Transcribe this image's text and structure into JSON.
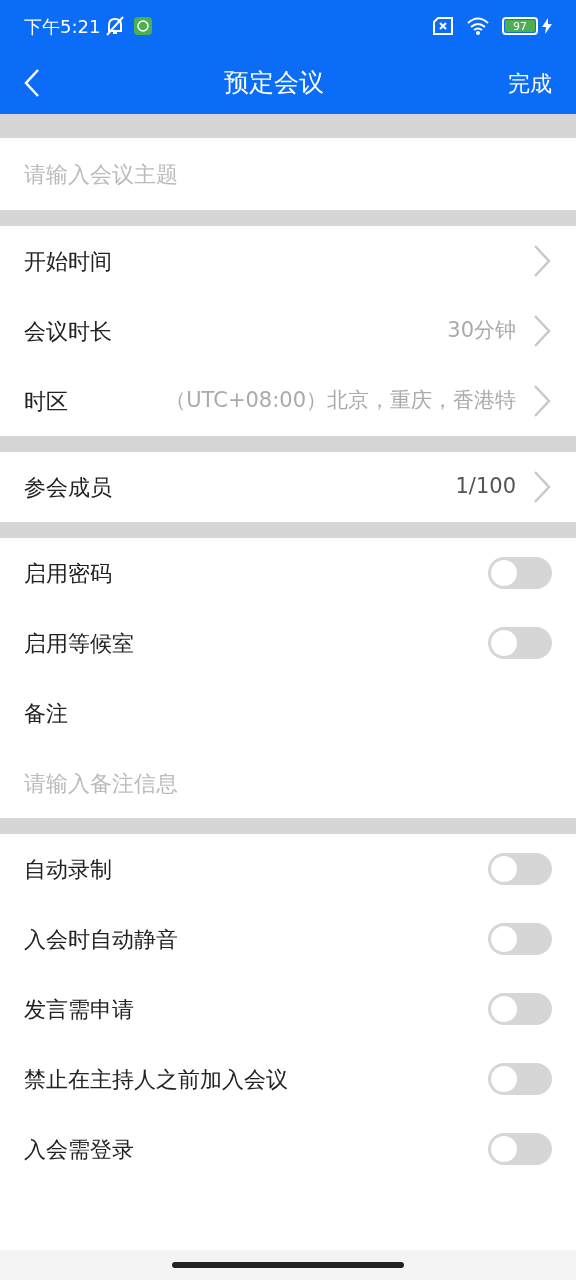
{
  "status_bar": {
    "time": "下午5:21",
    "battery": "97"
  },
  "nav": {
    "title": "预定会议",
    "action": "完成"
  },
  "topic": {
    "placeholder": "请输入会议主题"
  },
  "sections": [
    {
      "items": [
        {
          "kind": "nav",
          "label": "开始时间"
        },
        {
          "kind": "nav",
          "label": "会议时长",
          "value": "30分钟",
          "value_muted": true
        },
        {
          "kind": "nav",
          "label": "时区",
          "value": "（UTC+08:00）北京，重庆，香港特",
          "value_muted": true
        }
      ]
    },
    {
      "items": [
        {
          "kind": "nav",
          "label": "参会成员",
          "value": "1/100",
          "value_muted": false
        }
      ]
    },
    {
      "items": [
        {
          "kind": "toggle",
          "label": "启用密码",
          "on": false
        },
        {
          "kind": "toggle",
          "label": "启用等候室",
          "on": false
        },
        {
          "kind": "label",
          "label": "备注"
        },
        {
          "kind": "field",
          "placeholder": "请输入备注信息"
        }
      ]
    },
    {
      "items": [
        {
          "kind": "toggle",
          "label": "自动录制",
          "on": false
        },
        {
          "kind": "toggle",
          "label": "入会时自动静音",
          "on": false
        },
        {
          "kind": "toggle",
          "label": "发言需申请",
          "on": false
        },
        {
          "kind": "toggle",
          "label": "禁止在主持人之前加入会议",
          "on": false
        },
        {
          "kind": "toggle",
          "label": "入会需登录",
          "on": false
        }
      ]
    }
  ]
}
